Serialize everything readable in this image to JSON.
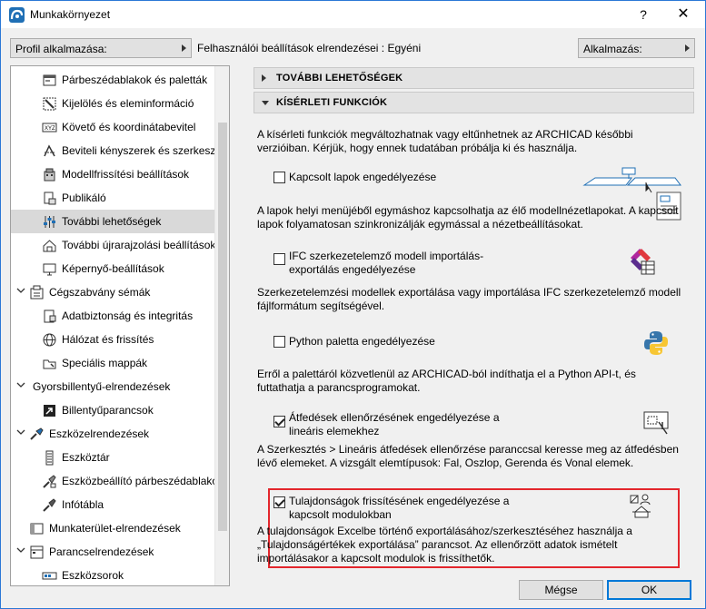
{
  "window": {
    "title": "Munkakörnyezet",
    "help": "?",
    "close": "✕"
  },
  "toolbar": {
    "profile_button": "Profil alkalmazása:",
    "profile_text": "Felhasználói beállítások elrendezései : Egyéni",
    "apply_button": "Alkalmazás:"
  },
  "tree": {
    "items": [
      {
        "label": "Párbeszédablakok és paletták",
        "icon": "dialog-palette-icon",
        "selected": false
      },
      {
        "label": "Kijelölés és eleminformáció",
        "icon": "selection-icon",
        "selected": false
      },
      {
        "label": "Követő és koordinátabevitel",
        "icon": "xyz-tracker-icon",
        "selected": false
      },
      {
        "label": "Beviteli kényszerek és szerkesztővonalak",
        "icon": "constraint-icon",
        "selected": false
      },
      {
        "label": "Modellfrissítési beállítások",
        "icon": "model-rebuild-icon",
        "selected": false
      },
      {
        "label": "Publikáló",
        "icon": "publisher-icon",
        "selected": false
      },
      {
        "label": "További lehetőségek",
        "icon": "more-options-icon",
        "selected": true
      },
      {
        "label": "További újrarajzolási beállítások",
        "icon": "redraw-icon",
        "selected": false
      },
      {
        "label": "Képernyő-beállítások",
        "icon": "screen-icon",
        "selected": false
      },
      {
        "label": "Cégszabvány sémák",
        "icon": "company-schemes-icon",
        "selected": false,
        "group": true
      },
      {
        "label": "Adatbiztonság és integritás",
        "icon": "data-safety-icon",
        "selected": false
      },
      {
        "label": "Hálózat és frissítés",
        "icon": "network-globe-icon",
        "selected": false
      },
      {
        "label": "Speciális mappák",
        "icon": "special-folders-icon",
        "selected": false
      },
      {
        "label": "Gyorsbillentyű-elrendezések",
        "icon": "shortcut-schemes-icon",
        "selected": false,
        "group": true
      },
      {
        "label": "Billentyűparancsok",
        "icon": "keyboard-shortcut-icon",
        "selected": false
      },
      {
        "label": "Eszközelrendezések",
        "icon": "tool-schemes-icon",
        "selected": false,
        "group": true
      },
      {
        "label": "Eszköztár",
        "icon": "toolbox-icon",
        "selected": false
      },
      {
        "label": "Eszközbeállító párbeszédablakok",
        "icon": "tool-settings-icon",
        "selected": false
      },
      {
        "label": "Infótábla",
        "icon": "info-box-icon",
        "selected": false
      },
      {
        "label": "Munkaterület-elrendezések",
        "icon": "work-environment-icon",
        "selected": false,
        "group": true
      },
      {
        "label": "Parancselrendezések",
        "icon": "command-schemes-icon",
        "selected": false,
        "group": true
      },
      {
        "label": "Eszközsorok",
        "icon": "toolbars-icon",
        "selected": false
      }
    ]
  },
  "content": {
    "section_more": "TOVÁBBI LEHETŐSÉGEK",
    "section_experimental": "KÍSÉRLETI FUNKCIÓK",
    "intro": "A kísérleti funkciók megváltozhatnak vagy eltűnhetnek az ARCHICAD későbbi verzióiban. Kérjük, hogy ennek tudatában próbálja ki és használja.",
    "features": [
      {
        "checkbox_label": "Kapcsolt lapok engedélyezése",
        "checked": false,
        "icon": "linked-sheets-icon",
        "description": "A lapok helyi menüjéből egymáshoz kapcsolhatja az élő modellnézetlapokat. A kapcsolt lapok folyamatosan szinkronizálják egymással a nézetbeállításokat."
      },
      {
        "checkbox_label": "IFC szerkezetelemző modell importálás-exportálás engedélyezése",
        "checked": false,
        "icon": "ifc-structural-icon",
        "description": "Szerkezetelemzési modellek exportálása vagy importálása IFC szerkezetelemző modell fájlformátum segítségével."
      },
      {
        "checkbox_label": "Python paletta engedélyezése",
        "checked": false,
        "icon": "python-icon",
        "description": "Erről a palettáról közvetlenül az ARCHICAD-ból indíthatja el a Python API-t, és futtathatja a parancsprogramokat."
      },
      {
        "checkbox_label": "Átfedések ellenőrzésének engedélyezése a lineáris elemekhez",
        "checked": true,
        "icon": "collision-check-icon",
        "description": "A Szerkesztés > Lineáris átfedések ellenőrzése paranccsal keresse meg az átfedésben lévő elemeket. A vizsgált elemtípusok: Fal, Oszlop, Gerenda és Vonal elemek."
      },
      {
        "checkbox_label": "Tulajdonságok frissítésének engedélyezése a kapcsolt modulokban",
        "checked": true,
        "icon": "property-update-icon",
        "description": "A tulajdonságok Excelbe történő exportálásához/szerkesztéséhez használja a „Tulajdonságértékek exportálása” parancsot. Az ellenőrzött adatok ismételt importálásakor a kapcsolt modulok is frissíthetők."
      }
    ]
  },
  "buttons": {
    "cancel": "Mégse",
    "ok": "OK"
  },
  "colors": {
    "accent": "#0078d7",
    "highlight": "#e3262c",
    "selection": "#d9d9d9"
  }
}
